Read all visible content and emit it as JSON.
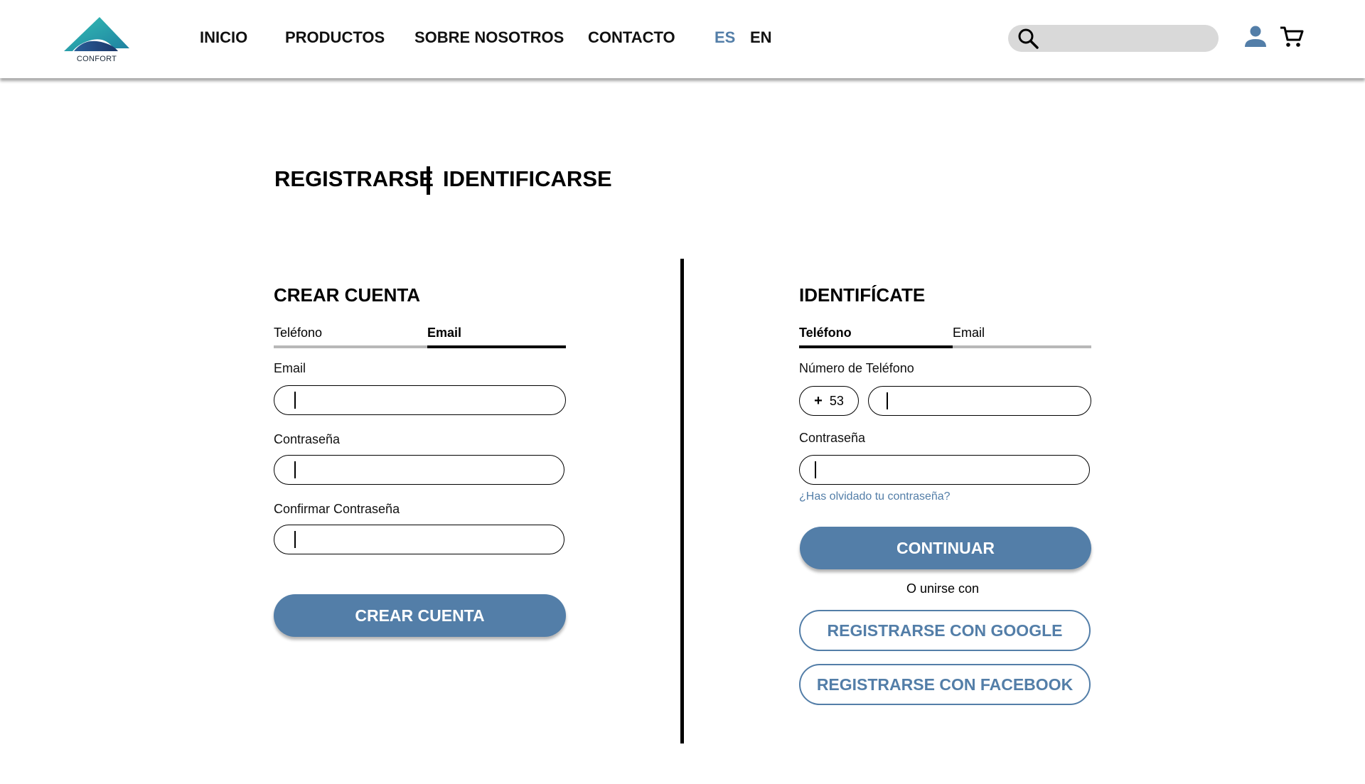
{
  "brand": {
    "name": "CONFORT",
    "colors": {
      "primary": "#537ea8",
      "logo_teal": "#2aa7a8",
      "logo_navy": "#1f3b6e"
    }
  },
  "nav": {
    "items": [
      {
        "label": "INICIO"
      },
      {
        "label": "PRODUCTOS"
      },
      {
        "label": "SOBRE NOSOTROS"
      },
      {
        "label": "CONTACTO"
      }
    ],
    "languages": [
      {
        "label": "ES",
        "active": true,
        "color": "#537ea8"
      },
      {
        "label": "EN",
        "active": false,
        "color": "#111111"
      }
    ]
  },
  "header": {
    "search": {
      "value": "",
      "placeholder": "",
      "icon": "search-icon"
    },
    "user_icon": "user-icon",
    "cart_icon": "cart-icon"
  },
  "page_tabs": {
    "register": "REGISTRARSE",
    "login": "IDENTIFICARSE"
  },
  "create_account": {
    "title": "CREAR CUENTA",
    "tabs": [
      {
        "label": "Teléfono",
        "active": false
      },
      {
        "label": "Email",
        "active": true
      }
    ],
    "email_label": "Email",
    "password_label": "Contraseña",
    "confirm_password_label": "Confirmar Contraseña",
    "submit_label": "CREAR CUENTA"
  },
  "login": {
    "title": "IDENTIFÍCATE",
    "tabs": [
      {
        "label": "Teléfono",
        "active": true
      },
      {
        "label": "Email",
        "active": false
      }
    ],
    "phone_label": "Número de Teléfono",
    "country_prefix_sign": "+",
    "country_code": "53",
    "password_label": "Contraseña",
    "forgot_password": "¿Has olvidado tu contraseña?",
    "continue_label": "CONTINUAR",
    "or_join_with": "O unirse con",
    "google_label": "REGISTRARSE CON GOOGLE",
    "facebook_label": "REGISTRARSE CON FACEBOOK"
  }
}
